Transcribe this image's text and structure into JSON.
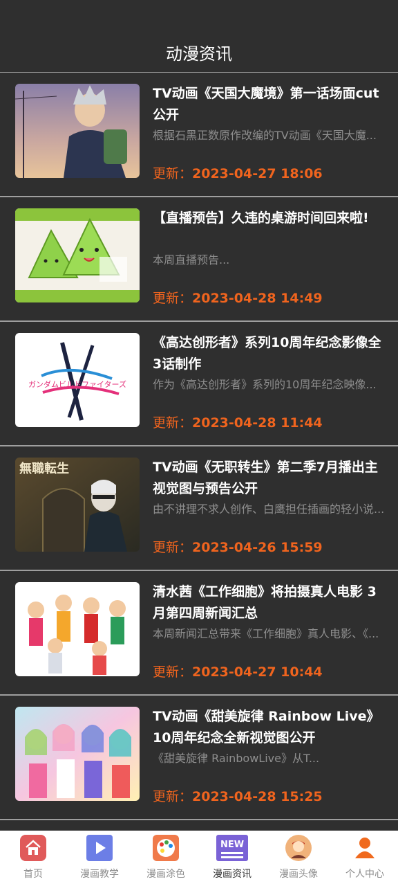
{
  "header": {
    "title": "动漫资讯"
  },
  "date_label": "更新：",
  "news": [
    {
      "title": "TV动画《天国大魔境》第一话场面cut公开",
      "summary": "根据石黑正数原作改编的TV动画《天国大魔...",
      "date": "2023-04-27 18:06"
    },
    {
      "title": "【直播预告】久违的桌游时间回来啦!",
      "summary": "本周直播预告...",
      "date": "2023-04-28 14:49"
    },
    {
      "title": "《高达创形者》系列10周年纪念影像全3话制作",
      "summary": "作为《高达创形者》系列的10周年纪念映像...",
      "date": "2023-04-28 11:44",
      "thumb_text": "ガンダムビルドファイターズ"
    },
    {
      "title": "TV动画《无职转生》第二季7月播出主视觉图与预告公开",
      "summary": "由不讲理不求人创作、白鹰担任插画的轻小说...",
      "date": "2023-04-26 15:59",
      "thumb_text": "無職転生"
    },
    {
      "title": "清水茜《工作细胞》将拍摄真人电影 3月第四周新闻汇总",
      "summary": "本周新闻汇总带来《工作细胞》真人电影、《...",
      "date": "2023-04-27 10:44"
    },
    {
      "title": "TV动画《甜美旋律 Rainbow Live》10周年纪念全新视觉图公开",
      "summary": "《甜美旋律 RainbowLive》从T...",
      "date": "2023-04-28 15:25"
    }
  ],
  "tabs": [
    {
      "label": "首页",
      "icon": "home-icon",
      "color": "#e05a5a"
    },
    {
      "label": "漫画教学",
      "icon": "play-icon",
      "color": "#6c7ee6"
    },
    {
      "label": "漫画涂色",
      "icon": "palette-icon",
      "color": "#f07a4a"
    },
    {
      "label": "漫画资讯",
      "icon": "new-icon",
      "color": "#7a62d6",
      "badge": "NEW",
      "active": true
    },
    {
      "label": "漫画头像",
      "icon": "avatar-icon",
      "color": "#f0b27a"
    },
    {
      "label": "个人中心",
      "icon": "person-icon",
      "color": "#f06a1e"
    }
  ]
}
